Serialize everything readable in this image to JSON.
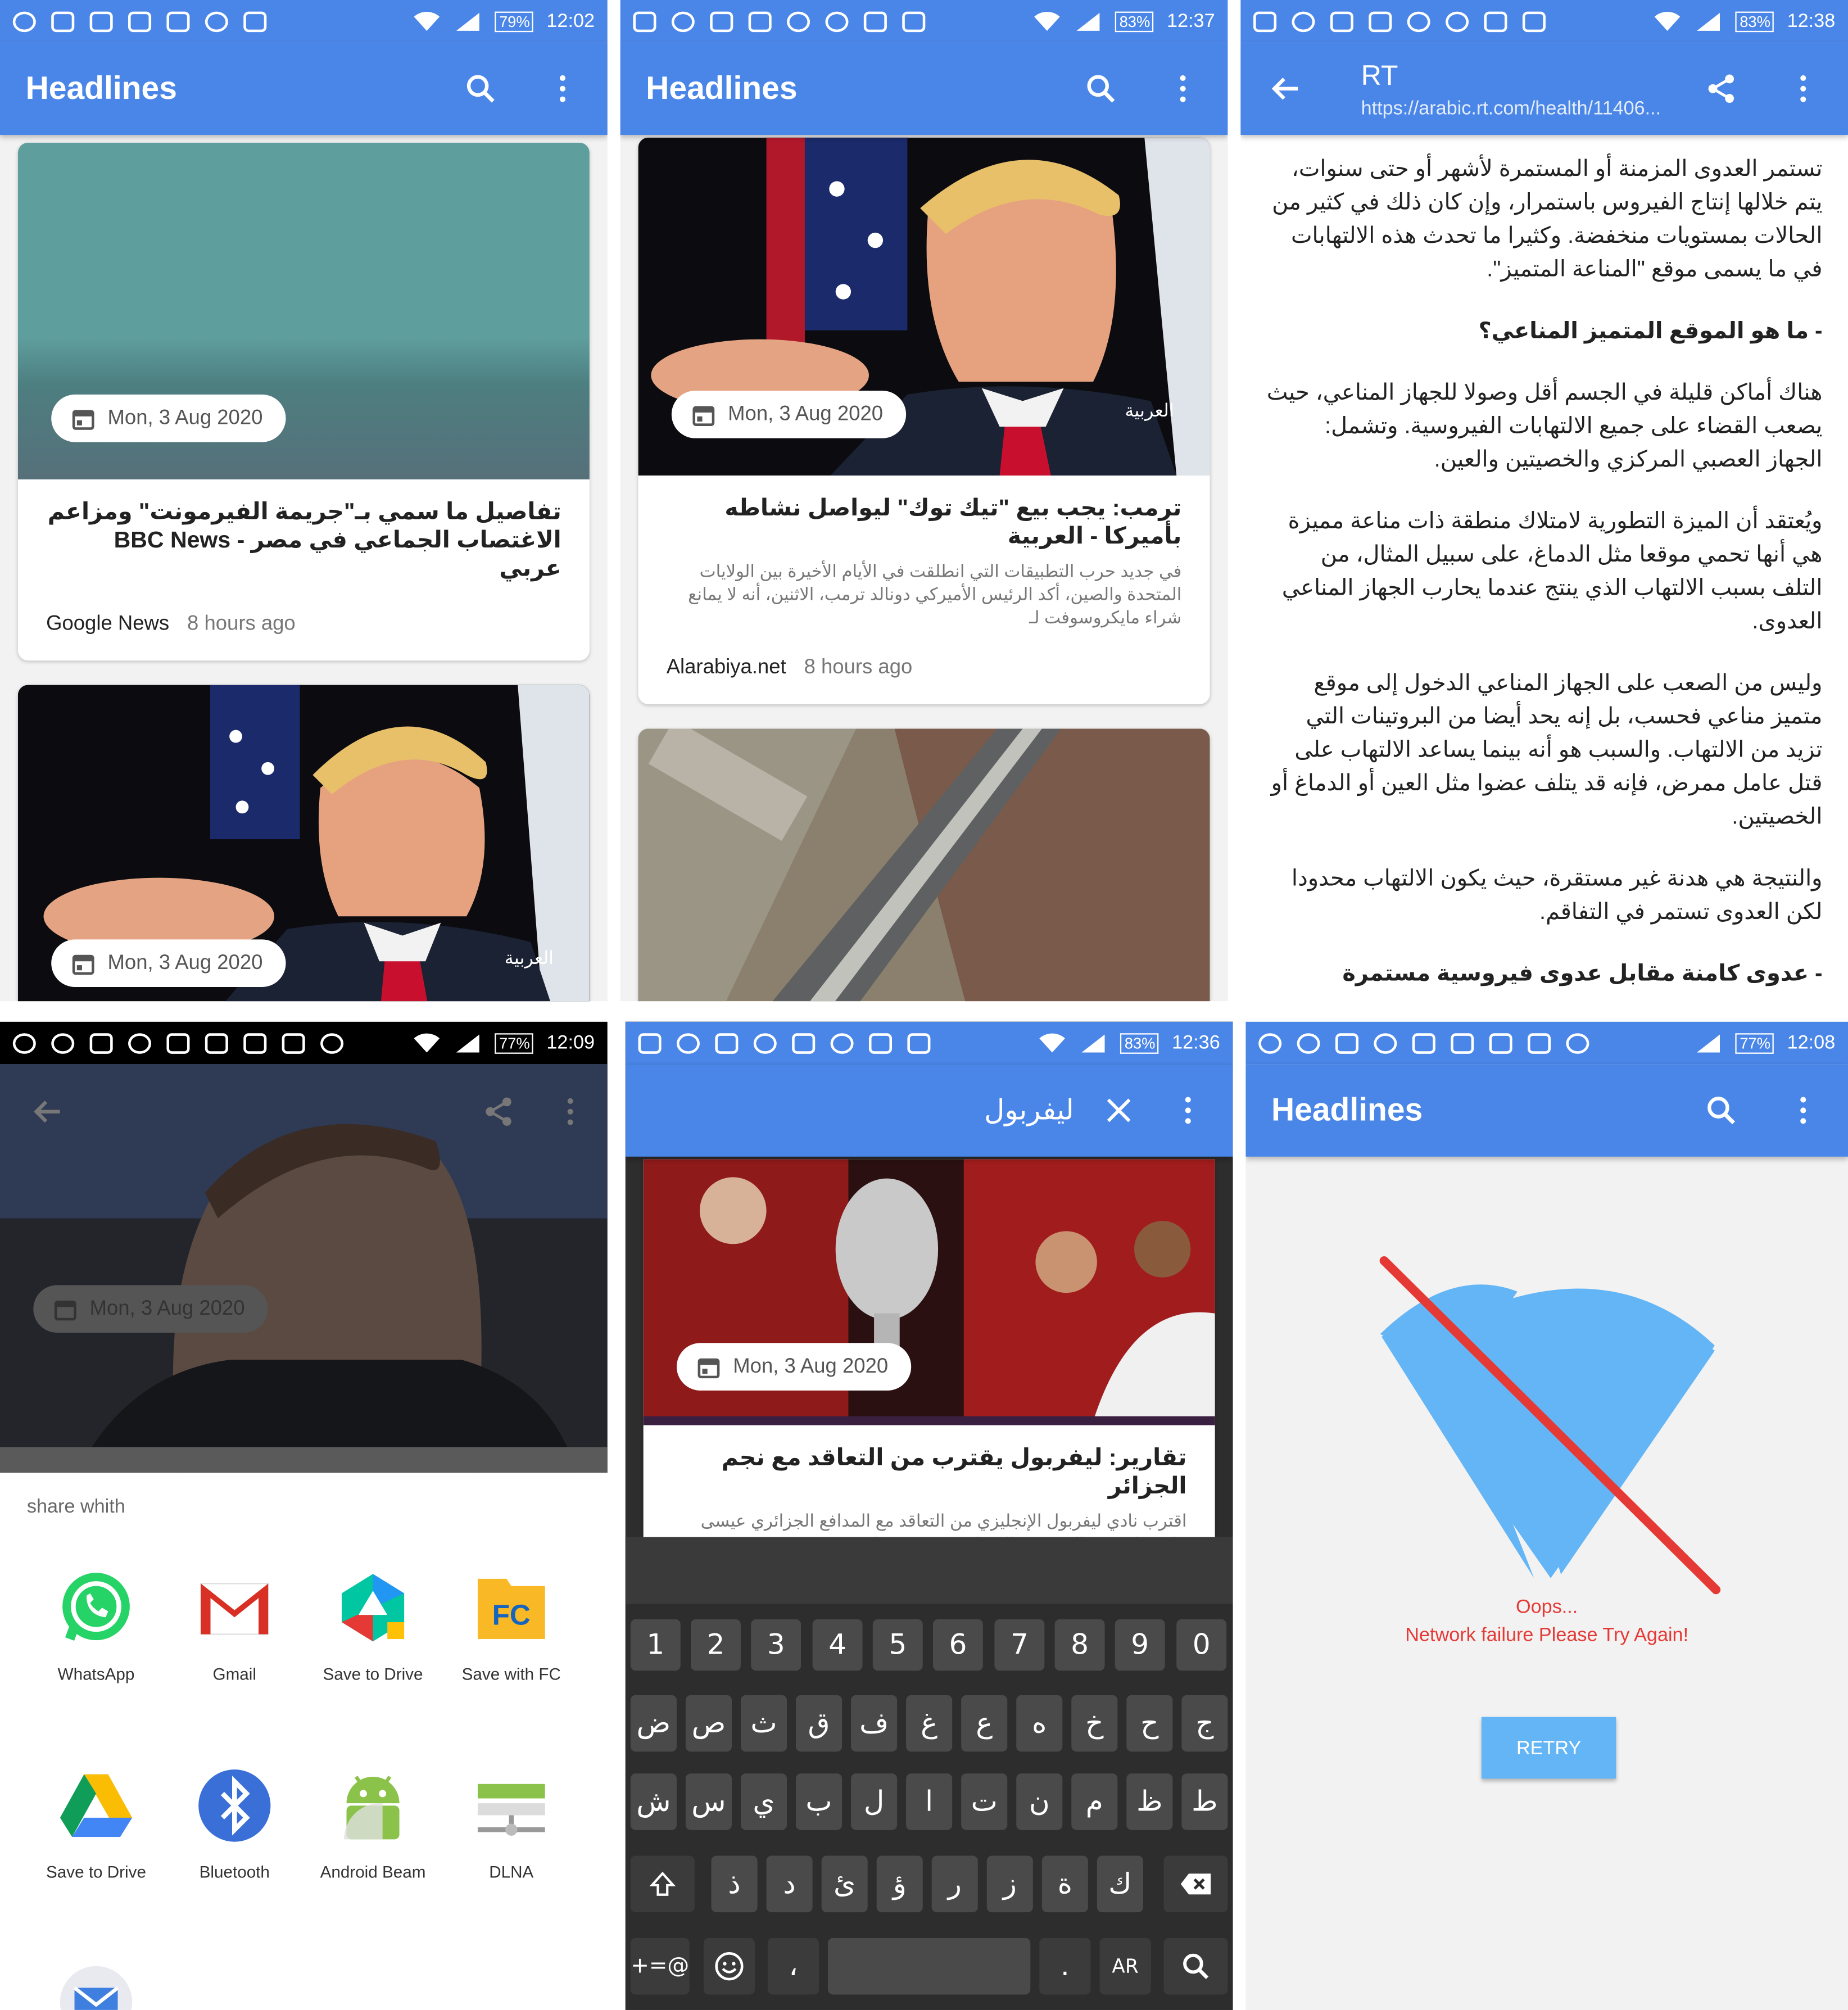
{
  "colors": {
    "primary": "#4a86e8",
    "error": "#e53935",
    "retry": "#64b5f6"
  },
  "panel1": {
    "status": {
      "battery": "79%",
      "time": "12:02"
    },
    "title": "Headlines",
    "card1": {
      "date": "Mon, 3 Aug 2020",
      "title": "تفاصيل ما سمي بـ\"جريمة الفيرمونت\" ومزاعم الاغتصاب الجماعي في مصر - BBC News عربي",
      "source": "Google News",
      "time": "8 hours ago"
    },
    "card2": {
      "date": "Mon, 3 Aug 2020",
      "watermark": "العربية"
    }
  },
  "panel2": {
    "status": {
      "battery": "83%",
      "time": "12:37"
    },
    "title": "Headlines",
    "card1": {
      "date": "Mon, 3 Aug 2020",
      "watermark": "العربية",
      "title": "ترمب: يجب بيع \"تيك توك\" ليواصل نشاطه بأميركا - العربية",
      "desc": "في جديد حرب التطبيقات التي انطلقت في الأيام الأخيرة بين الولايات المتحدة والصين، أكد الرئيس الأميركي دونالد ترمب، الاثنين، أنه لا يمانع شراء مايكروسوفت لـ",
      "source": "Alarabiya.net",
      "time": "8 hours ago"
    }
  },
  "panel3": {
    "status": {
      "battery": "83%",
      "time": "12:38"
    },
    "title": "RT",
    "url": "https://arabic.rt.com/health/11406...",
    "paragraphs": [
      "تستمر العدوى المزمنة أو المستمرة لأشهر أو حتى سنوات، يتم خلالها إنتاج الفيروس باستمرار، وإن كان ذلك في كثير من الحالات بمستويات منخفضة. وكثيرا ما تحدث هذه الالتهابات في ما يسمى موقع \"المناعة المتميز\".",
      "- ما هو الموقع المتميز المناعي؟",
      "هناك أماكن قليلة في الجسم أقل وصولا للجهاز المناعي، حيث يصعب القضاء على جميع الالتهابات الفيروسية. وتشمل: الجهاز العصبي المركزي والخصيتين والعين.",
      "ويُعتقد أن الميزة التطورية لامتلاك منطقة ذات مناعة مميزة هي أنها تحمي موقعا مثل الدماغ، على سبيل المثال، من التلف بسبب الالتهاب الذي ينتج عندما يحارب الجهاز المناعي العدوى.",
      "وليس من الصعب على الجهاز المناعي الدخول إلى موقع متميز مناعي فحسب، بل إنه يحد أيضا من البروتينات التي تزيد من الالتهاب. والسبب هو أنه بينما يساعد الالتهاب على قتل عامل ممرض، فإنه قد يتلف عضوا مثل العين أو الدماغ أو الخصيتين.",
      "والنتيجة هي هدنة غير مستقرة، حيث يكون الالتهاب محدودا لكن العدوى تستمر في التفاقم.",
      "- عدوى كامنة مقابل عدوى فيروسية مستمرة"
    ]
  },
  "panel4": {
    "status": {
      "battery": "77%",
      "time": "12:09"
    },
    "date": "Mon, 3 Aug 2020",
    "share_title": "share whith",
    "apps": [
      {
        "label": "WhatsApp",
        "icon": "whatsapp-icon"
      },
      {
        "label": "Gmail",
        "icon": "gmail-icon"
      },
      {
        "label": "Save to Drive",
        "icon": "drive-icon"
      },
      {
        "label": "Save with FC",
        "icon": "fc-icon"
      },
      {
        "label": "Save to Drive",
        "icon": "drive-icon"
      },
      {
        "label": "Bluetooth",
        "icon": "bluetooth-icon"
      },
      {
        "label": "Android Beam",
        "icon": "android-icon"
      },
      {
        "label": "DLNA",
        "icon": "dlna-icon"
      }
    ]
  },
  "panel5": {
    "status": {
      "battery": "83%",
      "time": "12:36"
    },
    "query": "ليفربول",
    "date": "Mon, 3 Aug 2020",
    "title": "تقارير: ليفربول يقترب من التعاقد مع نجم الجزائر",
    "desc": "اقترب نادي ليفربول الإنجليزي من التعاقد مع المدافع الجزائري عيسى ماندي لاعب ريال بيتيس الإسباني، بحسب تقارير صحفية.",
    "keys": {
      "row1": [
        "1",
        "2",
        "3",
        "4",
        "5",
        "6",
        "7",
        "8",
        "9",
        "0"
      ],
      "row2": [
        "ض",
        "ص",
        "ث",
        "ق",
        "ف",
        "غ",
        "ع",
        "ه",
        "خ",
        "ح",
        "ج"
      ],
      "row3": [
        "ش",
        "س",
        "ي",
        "ب",
        "ل",
        "ا",
        "ت",
        "ن",
        "م",
        "ظ",
        "ط"
      ],
      "row4": [
        "ذ",
        "د",
        "ئ",
        "ؤ",
        "ر",
        "ز",
        "ة",
        "ك"
      ],
      "symbols": "+=@",
      "comma": "،",
      "period": ".",
      "lang": "AR"
    }
  },
  "panel6": {
    "status": {
      "battery": "77%",
      "time": "12:08"
    },
    "title": "Headlines",
    "oops": "Oops...",
    "message": "Network failure Please Try Again!",
    "retry": "RETRY"
  }
}
